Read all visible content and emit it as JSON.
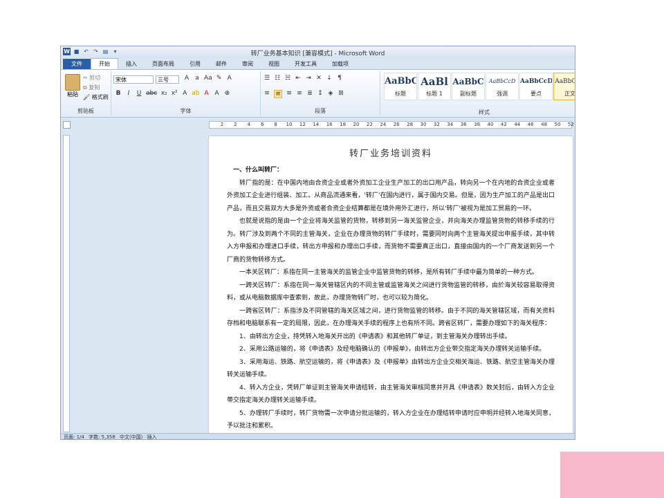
{
  "window": {
    "title": "转厂业务基本知识 [兼容模式] - Microsoft Word",
    "qat_icons": [
      "word-icon",
      "save-icon",
      "undo-icon",
      "redo-icon",
      "print-icon",
      "customize-icon"
    ]
  },
  "tabs": [
    "文件",
    "开始",
    "插入",
    "页面布局",
    "引用",
    "邮件",
    "审阅",
    "视图",
    "开发工具",
    "加载项"
  ],
  "ribbon": {
    "clipboard": {
      "paste": "粘贴",
      "cut": "剪切",
      "copy": "复制",
      "format_painter": "格式刷",
      "label": "剪贴板"
    },
    "font": {
      "name": "宋体",
      "size": "三号",
      "label": "字体"
    },
    "paragraph": {
      "label": "段落"
    },
    "styles": {
      "label": "样式",
      "items": [
        {
          "preview": "AaBbC",
          "name": "标题"
        },
        {
          "preview": "AaBl",
          "name": "标题 1"
        },
        {
          "preview": "AaBbC",
          "name": "副标题"
        },
        {
          "preview": "AaBbCcD",
          "name": "强调"
        },
        {
          "preview": "AaBbCcD",
          "name": "要点"
        },
        {
          "preview": "AaBbCcD",
          "name": "正文"
        }
      ]
    }
  },
  "ruler": [
    "2",
    "2",
    "4",
    "6",
    "8",
    "10",
    "12",
    "14",
    "16",
    "18",
    "20",
    "22",
    "24",
    "26",
    "28",
    "30",
    "32",
    "34",
    "36",
    "38",
    "40",
    "42",
    "44",
    "46",
    "48",
    "50",
    "52"
  ],
  "document": {
    "title": "转厂业务培训资料",
    "heading": "一、什么叫转厂：",
    "paragraphs": [
      "转厂指的是：在中国内地由合资企业或者外资加工企业生产加工的出口用产品，转向另一个在内地的合资企业或者外资加工企业进行组装、加工。从商品流通来看，'转厂'在国内进行，属于国内交易。但是，因为生产加工的产品是出口产品，而且交易双方大多是外资或者合资企业结算都是在境外用外汇进行，所以'转厂'被视为是加工贸易的一环。",
      "也就是说指的是由一个企业将海关监管的货物，转移到另一海关监管企业，并向海关办理监管货物的转移手续的行为。转厂涉及到两个不同的主管海关，企业在办理货物的转厂手续时，需要同时向两个主管海关提出申报手续，其中转入方申报和办理进口手续，转出方申报和办理出口手续，而货物不需要真正出口，直接由国内的一个厂商发送到另一个厂商的货物转移方式。",
      "一本关区转厂：系指在同一主管海关的监管企业中监管货物的转移，是所有转厂手续中最为简单的一种方式。",
      "一跨关区转厂：系指在同一海关管辖区内的不同主管或监管海关之间进行货物监管的转移，由於海关较容易取得资料，或从电脑数据库中查索到，故此，办理货物转厂时，也可以较为简化。",
      "一跨省区转厂：系指涉及不同管辖的海关区域之间，进行货物监管的转移。由于不同的海关管辖区域，而有关资料存档和电脑联系有一定的局限，因此，在办理海关手续的程序上也有所不同。跨省区转厂，需要办理如下的海关程序：",
      "1、由转出方企业，持凭转入地海关开出的《申请表》和其他转厂单证，到主管海关办理转出手续。",
      "2、采用公路运输的，将《申请表》及经电脑确认的《申报单》，由转出方企业带交指定海关办理转关运输手续。",
      "3、采用海运、铁路、航空运输的，将《申请表》及《申报单》由转出方企业交相关海运、铁路、航空主管海关办理转关运输手续。",
      "4、转入方企业，凭转厂单证到主管海关申请结转，由主管海关审核同意并开具《申请表》数关封后，由转入方企业带交指定海关办理转关运输手续。",
      "5、办理转厂手续时，转厂货物需一次申请分批运输的，转入方企业在办理结转申请时应申明并经转入地海关同意，予以批注和累积。"
    ]
  },
  "statusbar": {
    "page": "页面: 1/4",
    "words": "字数: 5,358",
    "lang": "中文(中国)",
    "mode": "插入"
  }
}
